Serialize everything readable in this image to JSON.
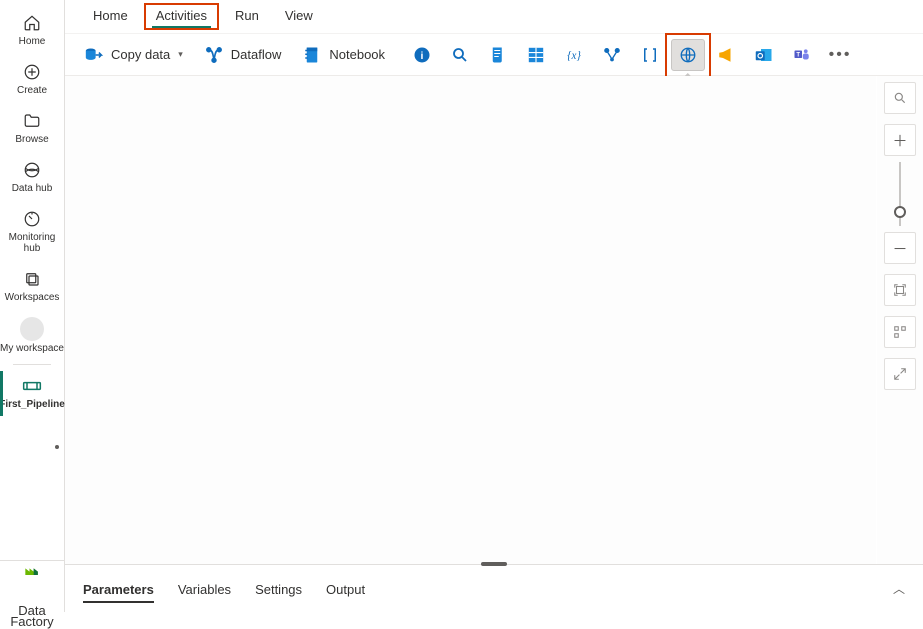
{
  "rail": {
    "home": "Home",
    "create": "Create",
    "browse": "Browse",
    "datahub": "Data hub",
    "monitoring": "Monitoring hub",
    "workspaces": "Workspaces",
    "myworkspace": "My workspace",
    "pipeline": "First_Pipeline",
    "datafactory": "Data Factory"
  },
  "topTabs": {
    "home": "Home",
    "activities": "Activities",
    "run": "Run",
    "view": "View"
  },
  "toolbar": {
    "copydata": "Copy data",
    "dataflow": "Dataflow",
    "notebook": "Notebook"
  },
  "tooltip": {
    "web": "Web"
  },
  "bottomTabs": {
    "parameters": "Parameters",
    "variables": "Variables",
    "settings": "Settings",
    "output": "Output"
  }
}
